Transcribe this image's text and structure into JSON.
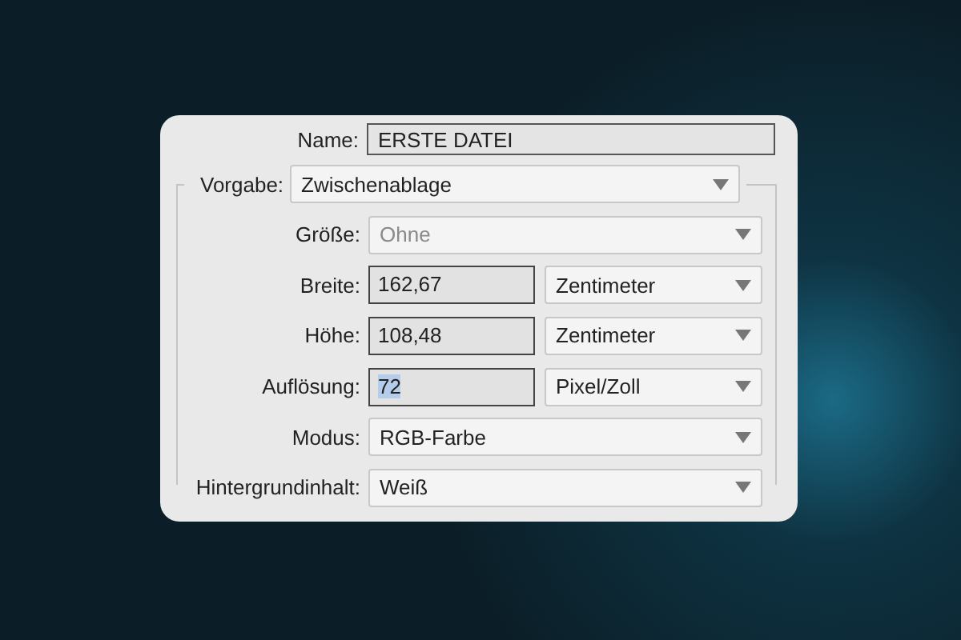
{
  "name_field": {
    "label": "Name:",
    "value": "ERSTE DATEI"
  },
  "preset": {
    "label": "Vorgabe:",
    "value": "Zwischenablage"
  },
  "rows": [
    {
      "kind": "select",
      "label": "Größe:",
      "value": "Ohne",
      "disabled": true
    },
    {
      "kind": "number",
      "label": "Breite:",
      "value": "162,67",
      "text_selected": false,
      "unit": "Zentimeter"
    },
    {
      "kind": "number",
      "label": "Höhe:",
      "value": "108,48",
      "text_selected": false,
      "unit": "Zentimeter"
    },
    {
      "kind": "number",
      "label": "Auflösung:",
      "value": "72",
      "text_selected": true,
      "unit": "Pixel/Zoll"
    },
    {
      "kind": "select",
      "label": "Modus:",
      "value": "RGB-Farbe",
      "disabled": false
    },
    {
      "kind": "select",
      "label": "Hintergrundinhalt:",
      "value": "Weiß",
      "disabled": false
    }
  ]
}
